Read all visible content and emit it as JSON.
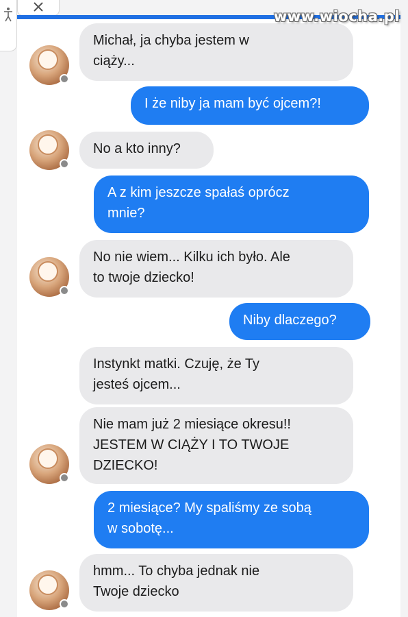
{
  "watermark": "www.wiocha.pl",
  "colors": {
    "accent": "#1f6fe3",
    "outgoing_bubble": "#1f7df2",
    "incoming_bubble": "#e9e9eb"
  },
  "icons": {
    "accessibility": "accessibility-icon",
    "close": "close-icon",
    "avatar": "avatar-photo"
  },
  "messages": [
    {
      "from": "them",
      "lines": [
        "Michał, ja chyba jestem w",
        "ciąży..."
      ]
    },
    {
      "from": "me",
      "lines": [
        "I że niby ja mam być ojcem?!"
      ]
    },
    {
      "from": "them",
      "lines": [
        "No a kto inny?"
      ]
    },
    {
      "from": "me",
      "lines": [
        "A z kim jeszcze spałaś oprócz",
        "mnie?"
      ]
    },
    {
      "from": "them",
      "lines": [
        "No nie wiem... Kilku ich było. Ale",
        "to twoje dziecko!"
      ]
    },
    {
      "from": "me",
      "lines": [
        "Niby dlaczego?"
      ]
    },
    {
      "from": "them",
      "lines": [
        "Instynkt matki. Czuję, że Ty",
        "jesteś ojcem..."
      ]
    },
    {
      "from": "them",
      "lines": [
        "Nie mam już 2 miesiące okresu!!",
        "JESTEM W CIĄŻY I TO TWOJE",
        "DZIECKO!"
      ]
    },
    {
      "from": "me",
      "lines": [
        "2 miesiące? My spaliśmy ze sobą",
        "w sobotę..."
      ]
    },
    {
      "from": "them",
      "lines": [
        "hmm... To chyba jednak nie",
        "Twoje dziecko"
      ]
    }
  ]
}
